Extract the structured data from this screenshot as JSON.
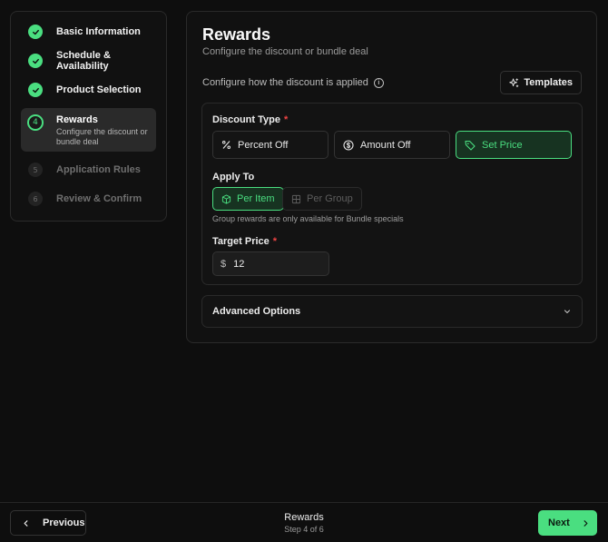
{
  "steps": [
    {
      "num": "✓",
      "label": "Basic Information",
      "state": "done"
    },
    {
      "num": "✓",
      "label": "Schedule & Availability",
      "state": "done"
    },
    {
      "num": "✓",
      "label": "Product Selection",
      "state": "done"
    },
    {
      "num": "4",
      "label": "Rewards",
      "desc": "Configure the discount or bundle deal",
      "state": "active"
    },
    {
      "num": "5",
      "label": "Application Rules",
      "state": "pending"
    },
    {
      "num": "6",
      "label": "Review & Confirm",
      "state": "pending"
    }
  ],
  "main": {
    "title": "Rewards",
    "subtitle": "Configure the discount or bundle deal",
    "config_text": "Configure how the discount is applied",
    "info_glyph": "i",
    "templates_label": "Templates"
  },
  "discount": {
    "label": "Discount Type",
    "required": "*",
    "options": [
      "Percent Off",
      "Amount Off",
      "Set Price"
    ],
    "selected": "Set Price"
  },
  "apply_to": {
    "label": "Apply To",
    "options": [
      "Per Item",
      "Per Group"
    ],
    "selected": "Per Item",
    "hint": "Group rewards are only available for Bundle specials"
  },
  "target_price": {
    "label": "Target Price",
    "required": "*",
    "currency": "$",
    "value": "12"
  },
  "advanced": {
    "label": "Advanced Options"
  },
  "footer": {
    "prev_label": "Previous",
    "title": "Rewards",
    "step_text": "Step 4 of 6",
    "next_label": "Next"
  },
  "colors": {
    "accent": "#4ade80",
    "required": "#ef4444",
    "background": "#0e0e0e"
  }
}
